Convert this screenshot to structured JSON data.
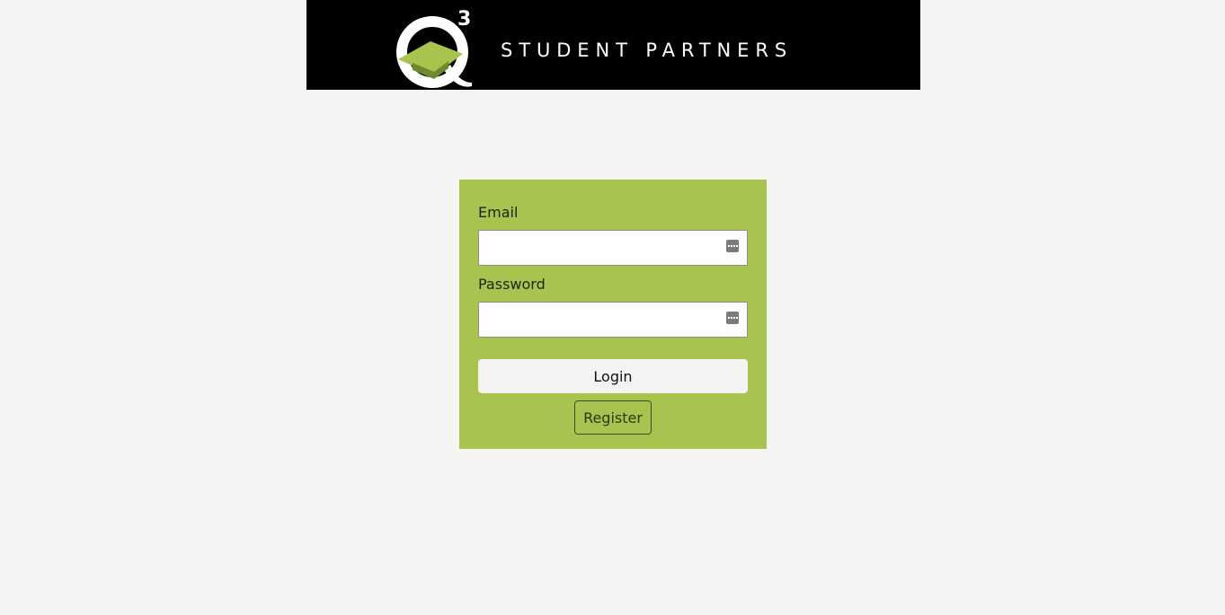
{
  "header": {
    "brand_name": "STUDENT PARTNERS",
    "logo": {
      "icon": "q3-graduation-cap-logo",
      "superscript": "3",
      "letter": "Q"
    },
    "background_color": "#000000"
  },
  "login_form": {
    "background_color": "#a8c34e",
    "email": {
      "label": "Email",
      "value": "",
      "placeholder": "",
      "icon": "password-manager-icon"
    },
    "password": {
      "label": "Password",
      "value": "",
      "placeholder": "",
      "icon": "password-manager-icon"
    },
    "login_label": "Login",
    "register_label": "Register"
  },
  "page": {
    "background_color": "#f4f4f2"
  }
}
